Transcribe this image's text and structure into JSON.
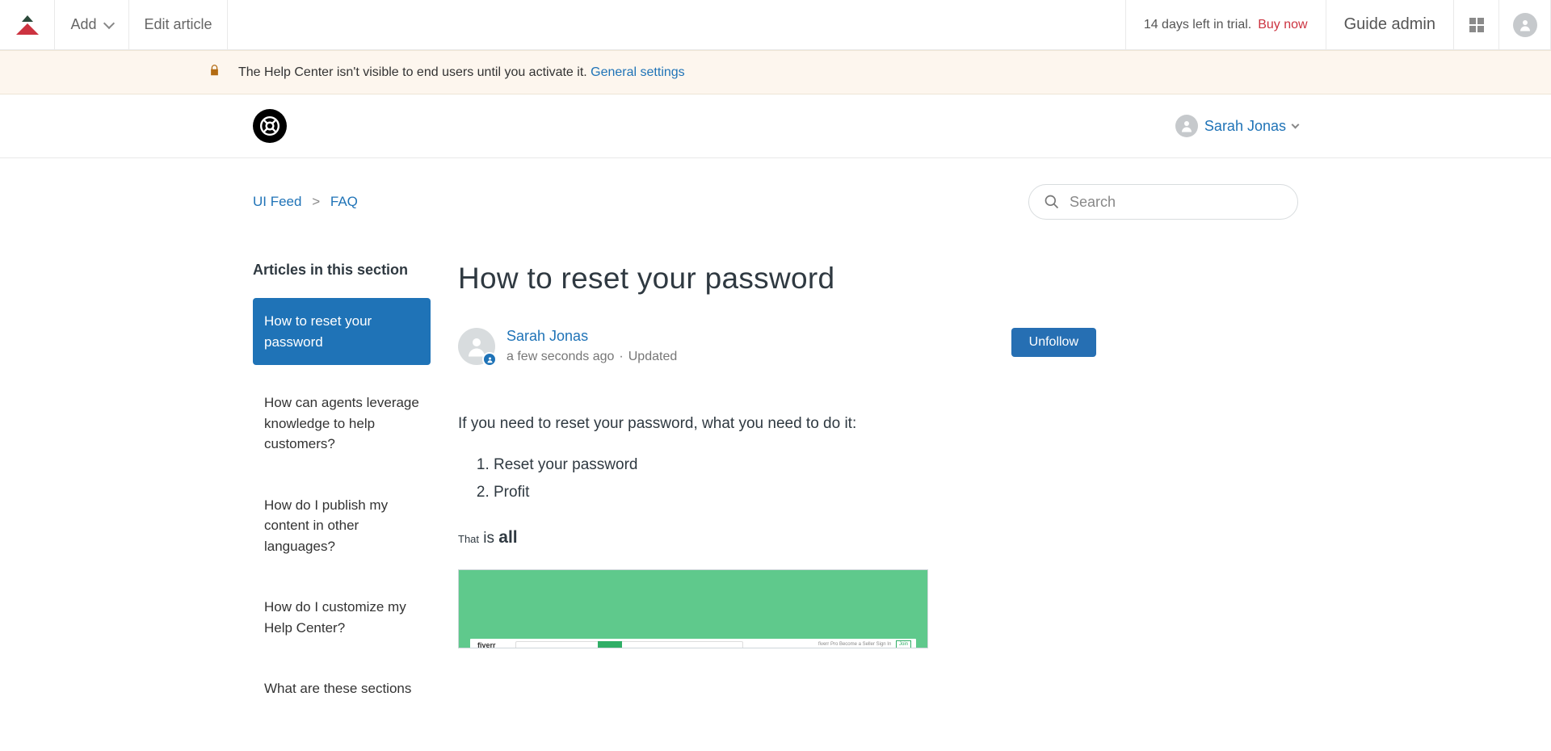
{
  "adminBar": {
    "addLabel": "Add",
    "editLabel": "Edit article",
    "trialText": "14 days left in trial.",
    "buyNow": "Buy now",
    "guideAdmin": "Guide admin"
  },
  "notice": {
    "text": "The Help Center isn't visible to end users until you activate it. ",
    "link": "General settings"
  },
  "hcHeader": {
    "userName": "Sarah Jonas"
  },
  "breadcrumb": {
    "root": "UI Feed",
    "section": "FAQ"
  },
  "search": {
    "placeholder": "Search"
  },
  "sidebar": {
    "title": "Articles in this section",
    "items": [
      "How to reset your password",
      "How can agents leverage knowledge to help customers?",
      "How do I publish my content in other languages?",
      "How do I customize my Help Center?",
      "What are these sections"
    ]
  },
  "article": {
    "title": "How to reset your password",
    "author": "Sarah Jonas",
    "time": "a few seconds ago",
    "updated": "Updated",
    "unfollow": "Unfollow",
    "intro": "If you need to reset your password, what you need to do it:",
    "steps": [
      "Reset your password",
      "Profit"
    ],
    "closing": {
      "that": "That",
      "is": " is ",
      "all": "all"
    },
    "fakeSite": {
      "brand": "fiverr",
      "right": "fiverr Pro   Become a Seller   Sign In",
      "join": "Join"
    }
  }
}
